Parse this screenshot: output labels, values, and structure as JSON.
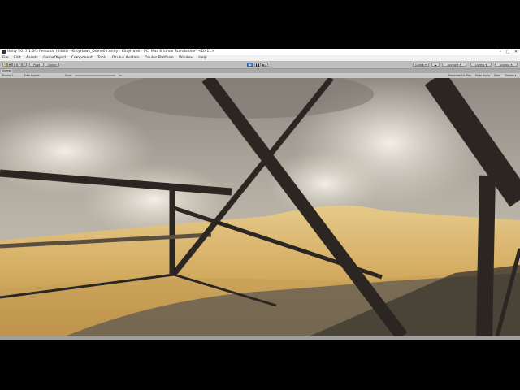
{
  "window": {
    "title": "Unity 2017.1.0f3 Personal (64bit) - KittyHawk_Demo01.unity - KittyHawk - PC, Mac & Linux Standalone* <DX11>",
    "minimize": "–",
    "maximize": "□",
    "close": "✕"
  },
  "menu": {
    "items": [
      "File",
      "Edit",
      "Assets",
      "GameObject",
      "Component",
      "Tools",
      "Oculus Avatars",
      "Oculus Platform",
      "Window",
      "Help"
    ]
  },
  "toolbar": {
    "pivot_label": "Pivot",
    "global_label": "Global",
    "collab_label": "Collab ▾",
    "account_label": "Account ▾",
    "layers_label": "Layers ▾",
    "layout_label": "Layout ▾"
  },
  "game": {
    "tab_label": "Game",
    "display_label": "Display 1",
    "aspect_label": "Free Aspect",
    "scale_label": "Scale",
    "scale_value": "1x",
    "maximize_label": "Maximize On Play",
    "mute_label": "Mute Audio",
    "stats_label": "Stats",
    "gizmos_label": "Gizmos ▾"
  },
  "colors": {
    "editor_bg": "#c2c2c2",
    "play_accent": "#3d7fd4",
    "sand": "#d9b56a",
    "sky": "#b9b4a8"
  }
}
